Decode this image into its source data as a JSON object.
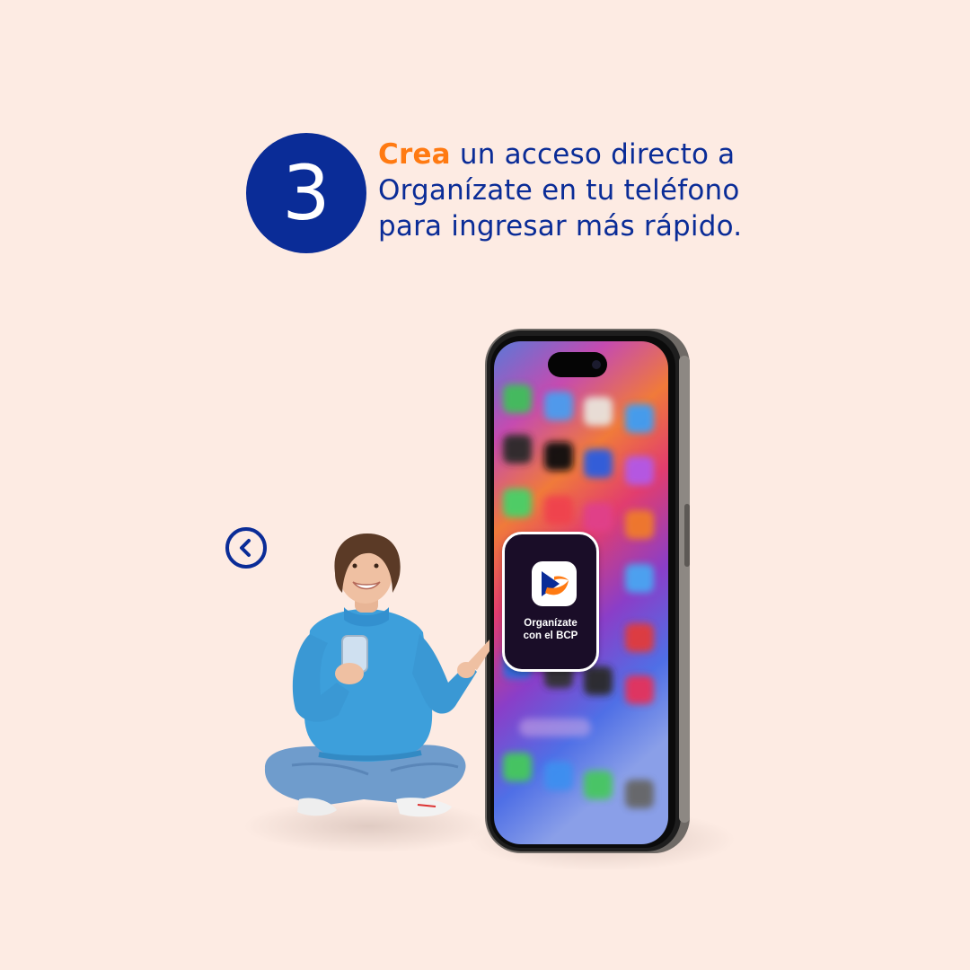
{
  "step": {
    "number": "3"
  },
  "headline": {
    "highlight": "Crea",
    "line1_rest": " un acceso directo a",
    "line2": "Organízate en tu teléfono",
    "line3": "para ingresar más rápido."
  },
  "shortcut": {
    "label": "Organízate\ncon el BCP",
    "icon": "bcp-logo-icon"
  },
  "navigation": {
    "back_icon": "chevron-left-icon"
  },
  "colors": {
    "background": "#fdebe3",
    "brand_blue": "#0a2c97",
    "accent_orange": "#ff7a12"
  }
}
